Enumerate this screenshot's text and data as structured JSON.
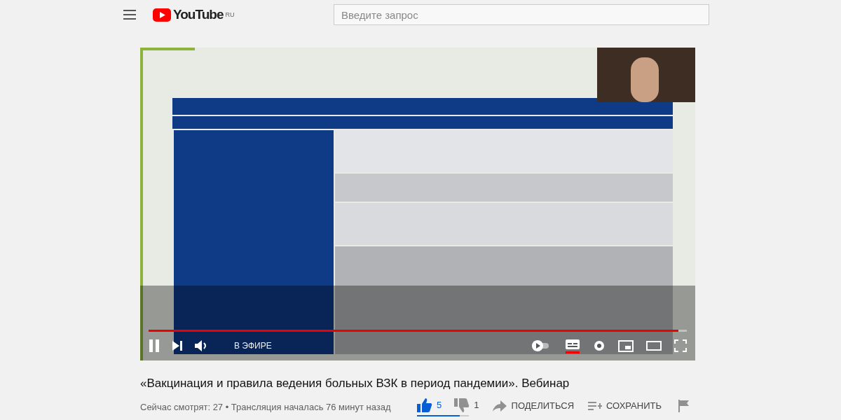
{
  "header": {
    "logo": "YouTube",
    "region": "RU",
    "search": {
      "placeholder": "Введите запрос"
    }
  },
  "player": {
    "progress": {
      "level": 0.985
    },
    "live_label": "В ЭФИРЕ",
    "controls": [
      {
        "kind": "pause"
      },
      {
        "kind": "next"
      },
      {
        "kind": "volume"
      }
    ],
    "right_controls": [
      {
        "kind": "autoplay",
        "on": false
      },
      {
        "kind": "subtitles",
        "on": true
      },
      {
        "kind": "settings"
      },
      {
        "kind": "miniplayer"
      },
      {
        "kind": "theater"
      },
      {
        "kind": "fullscreen"
      }
    ]
  },
  "video": {
    "title": "«Вакцинация и правила ведения больных ВЗК в период пандемии». Вебинар",
    "meta": "Сейчас смотрят: 27 • Трансляция началась 76 минут назад",
    "likes": {
      "count": "5",
      "selected": true
    },
    "dislikes": {
      "count": "1",
      "selected": false
    },
    "sentiment": {
      "level": 0.83
    },
    "actions": [
      {
        "kind": "share",
        "label": "ПОДЕЛИТЬСЯ"
      },
      {
        "kind": "save",
        "label": "СОХРАНИТЬ"
      },
      {
        "kind": "report"
      }
    ]
  }
}
